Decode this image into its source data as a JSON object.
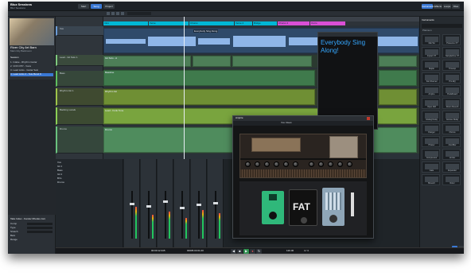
{
  "song": {
    "title": "Bluz Sessions",
    "subtitle": "Bluz Sessions"
  },
  "topbar": {
    "tabs": [
      "Start",
      "Song",
      "Project"
    ],
    "active_tab": "Song",
    "right_tabs": [
      "Instruments",
      "Effects",
      "Loops",
      "Files",
      "Cloud",
      "Shop",
      "Pool"
    ]
  },
  "browser_left": {
    "album_title": "River City Art Barn",
    "album_sub": "Main City Backroom",
    "section_title": "Session",
    "rows": [
      "1. Intake - Rhythm Guitar",
      "2. VOX DTP - Vocal",
      "3. Lead Licks - Guitar Solo",
      "4. Lead Licks 2 - Tele Bend 9"
    ],
    "footer_label": "Take Index - Fender Rhodes Jam",
    "footer_fields": [
      "Comp",
      "Type",
      "Stretch",
      "Bars",
      "Range"
    ]
  },
  "tracks": [
    {
      "name": "Vox",
      "color": "#6b9bd6",
      "clip_label": "Everybody Sing Along"
    },
    {
      "name": "Lead - Git Solo 1",
      "color": "#7fc97f",
      "clip_label": "Git Solo - A"
    },
    {
      "name": "Bass",
      "color": "#5fbf5f",
      "clip_label": "Bassline"
    },
    {
      "name": "Rhythm Git 1",
      "color": "#9ec44a",
      "clip_label": "Rhythm Git"
    },
    {
      "name": "Backing vocals",
      "color": "#8ccf55",
      "clip_label": "Lead - Funk Tone"
    },
    {
      "name": "Drums",
      "color": "#6ac27f",
      "clip_label": "Drums"
    }
  ],
  "arranger": {
    "section": "Intro",
    "markers": [
      "Intro",
      "Verse",
      "Chorus",
      "Verse 2",
      "Bridge",
      "Chorus 2",
      "Outro"
    ]
  },
  "video_overlay": {
    "text": "Everybody Sing Along!"
  },
  "plugin": {
    "title": "Ampire",
    "preset": "Vox Clean",
    "pedals": [
      "Distortion",
      "FAT",
      "Delay"
    ],
    "fat_label": "FAT"
  },
  "right_browser": {
    "header": "Instruments",
    "category": "Platinum",
    "tiles": [
      "Mai Tai",
      "Presence XT",
      "Impact XT",
      "SampleOne XT",
      "Mojito",
      "Tricomp",
      "Fat Channel",
      "Pro EQ",
      "Ampire",
      "Pedalboard",
      "Open AIR",
      "Room Reverb",
      "Analog Delay",
      "Groove Delay",
      "Flanger",
      "Chorus",
      "Phaser",
      "Autofilter",
      "Compressor",
      "Limiter",
      "Gate",
      "Expander",
      "Mixverb",
      "Rotor"
    ],
    "selected": "Ampire",
    "footer_btns": [
      "Mix",
      "Browse"
    ]
  },
  "console": {
    "channels": [
      "Vox",
      "Git 1",
      "Bass",
      "Git 2",
      "BVs",
      "Drums",
      "Keys",
      "Main"
    ]
  },
  "transport": {
    "time": "00:00:12.345",
    "bars": "00005.03.01.00",
    "tempo": "120.00",
    "signature": "4 / 4"
  }
}
